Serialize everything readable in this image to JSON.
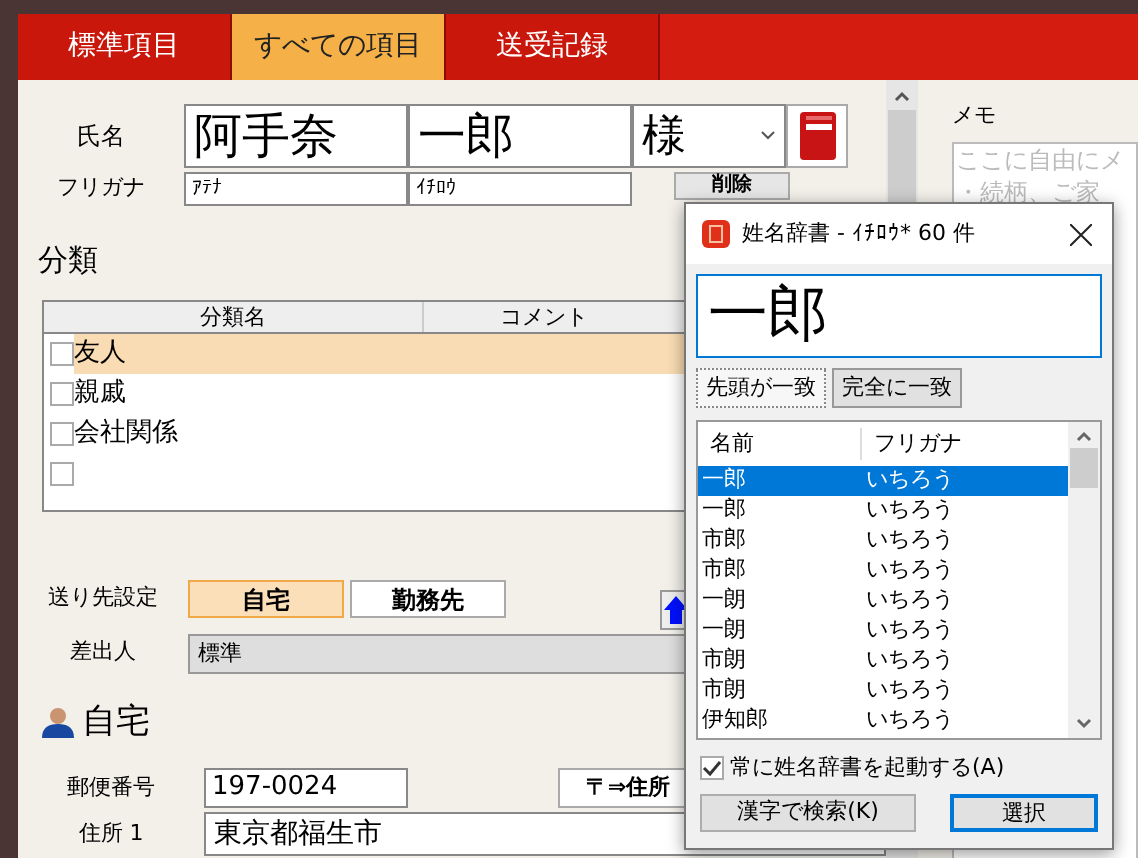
{
  "tabs": [
    {
      "label": "標準項目",
      "selected": false
    },
    {
      "label": "すべての項目",
      "selected": true
    },
    {
      "label": "送受記録",
      "selected": false
    }
  ],
  "name": {
    "label": "氏名",
    "last": "阿手奈",
    "first": "一郎",
    "honorific": "様",
    "furigana_label": "フリガナ",
    "furigana_last": "ｱﾃﾅ",
    "furigana_first": "ｲﾁﾛｳ",
    "delete_button": "削除"
  },
  "category": {
    "heading": "分類",
    "columns": [
      "分類名",
      "コメント"
    ],
    "rows": [
      {
        "name": "友人",
        "checked": false,
        "selected": true
      },
      {
        "name": "親戚",
        "checked": false,
        "selected": false
      },
      {
        "name": "会社関係",
        "checked": false,
        "selected": false
      },
      {
        "name": "",
        "checked": false,
        "selected": false
      }
    ]
  },
  "destination": {
    "label": "送り先設定",
    "options": [
      {
        "label": "自宅",
        "selected": true
      },
      {
        "label": "勤務先",
        "selected": false
      }
    ]
  },
  "sender": {
    "label": "差出人",
    "value": "標準"
  },
  "home": {
    "heading": "自宅",
    "postal_label": "郵便番号",
    "postal": "197-0024",
    "postal_button": "〒⇒住所",
    "address1_label": "住所 1",
    "address1": "東京都福生市"
  },
  "memo": {
    "label": "メモ",
    "placeholder_lines": [
      "ここに自由にメ",
      "・続柄、ご家"
    ]
  },
  "dialog": {
    "title": "姓名辞書 - ｲﾁﾛｳ* 60 件",
    "query": "一郎",
    "match_modes": [
      {
        "label": "先頭が一致",
        "selected": true
      },
      {
        "label": "完全に一致",
        "selected": false
      }
    ],
    "columns": [
      "名前",
      "フリガナ"
    ],
    "rows": [
      {
        "name": "一郎",
        "furigana": "いちろう",
        "selected": true
      },
      {
        "name": "一郎",
        "furigana": "いちろう",
        "selected": false
      },
      {
        "name": "市郎",
        "furigana": "いちろう",
        "selected": false
      },
      {
        "name": "市郎",
        "furigana": "いちろう",
        "selected": false
      },
      {
        "name": "一朗",
        "furigana": "いちろう",
        "selected": false
      },
      {
        "name": "一朗",
        "furigana": "いちろう",
        "selected": false
      },
      {
        "name": "市朗",
        "furigana": "いちろう",
        "selected": false
      },
      {
        "name": "市朗",
        "furigana": "いちろう",
        "selected": false
      },
      {
        "name": "伊知郎",
        "furigana": "いちろう",
        "selected": false
      }
    ],
    "always_launch": {
      "label": "常に姓名辞書を起動する(A)",
      "checked": true
    },
    "kanji_search_button": "漢字で検索(K)",
    "select_button": "選択"
  }
}
